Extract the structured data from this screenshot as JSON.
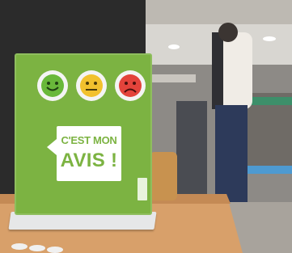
{
  "sign": {
    "line1": "C'EST MON",
    "line2": "AVIS !",
    "faces": [
      {
        "mood": "happy",
        "color": "#69b83a"
      },
      {
        "mood": "neutral",
        "color": "#f2c12e"
      },
      {
        "mood": "sad",
        "color": "#e3433b"
      }
    ]
  },
  "colors": {
    "sign_green": "#7cb342",
    "happy": "#69b83a",
    "neutral": "#f2c12e",
    "sad": "#e3433b"
  }
}
